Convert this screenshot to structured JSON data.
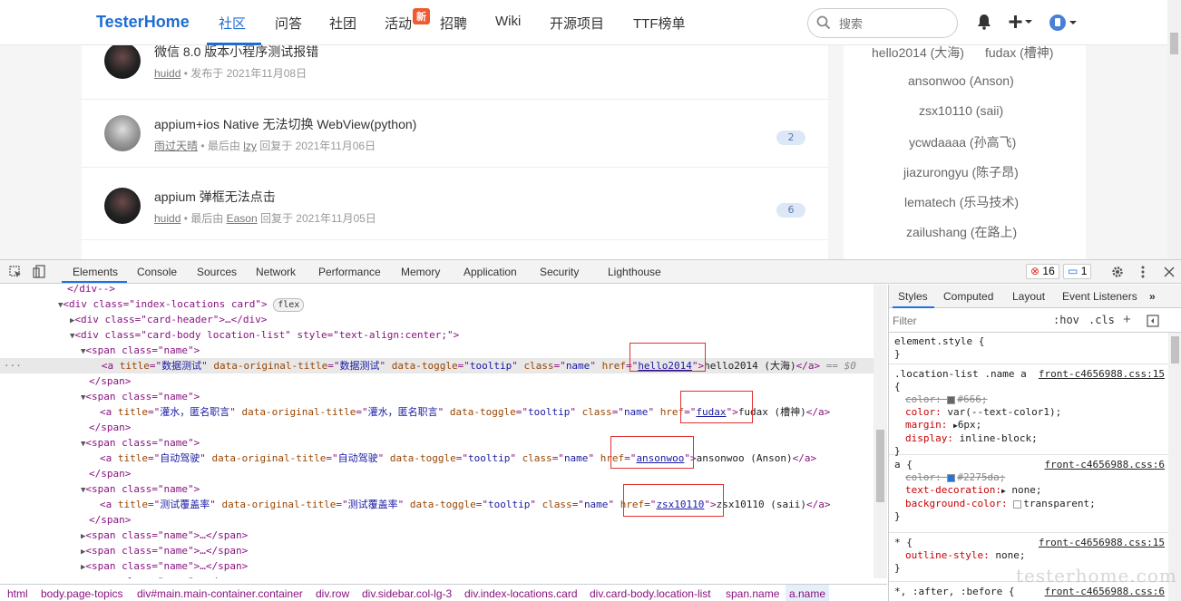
{
  "nav": {
    "brand": "TesterHome",
    "items": [
      "社区",
      "问答",
      "社团",
      "活动",
      "招聘",
      "Wiki",
      "开源项目",
      "TTF榜单"
    ],
    "badge": "新",
    "search_placeholder": "搜索"
  },
  "topics": [
    {
      "title": "微信 8.0 版本小程序测试报错",
      "author": "huidd",
      "meta": " • 发布于 2021年11月08日",
      "replier": "",
      "replies": ""
    },
    {
      "title": "appium+ios Native 无法切换 WebView(python)",
      "author": "雨过天晴",
      "meta_a": " • 最后由 ",
      "replier": "lzy",
      "meta_b": " 回复于 2021年11月06日",
      "replies": "2"
    },
    {
      "title": "appium 弹框无法点击",
      "author": "huidd",
      "meta_a": " • 最后由 ",
      "replier": "Eason",
      "meta_b": " 回复于 2021年11月05日",
      "replies": "6"
    }
  ],
  "locations": {
    "row1a": "hello2014 (大海)",
    "row1b": "fudax (槽神)",
    "others": [
      "ansonwoo (Anson)",
      "zsx10110 (saii)",
      "ycwdaaaa (孙高飞)",
      "jiazurongyu (陈子昂)",
      "lematech (乐马技术)",
      "zailushang (在路上)"
    ]
  },
  "devtools": {
    "tabs": [
      "Elements",
      "Console",
      "Sources",
      "Network",
      "Performance",
      "Memory",
      "Application",
      "Security",
      "Lighthouse"
    ],
    "errors": "16",
    "messages": "1",
    "style_tabs": [
      "Styles",
      "Computed",
      "Layout",
      "Event Listeners"
    ],
    "filter_placeholder": "Filter",
    "hov": ":hov",
    "cls": ".cls"
  },
  "dom": {
    "l0": "</div-->",
    "l1_tag": "<div class=\"index-locations card\">",
    "l1_flex": "flex",
    "l2": "<div class=\"card-header\">…</div>",
    "l3": "<div class=\"card-body location-list\" style=\"text-align:center;\">",
    "span_open": "<span class=\"name\">",
    "span_close": "</span>",
    "span_collapsed": "<span class=\"name\">…</span>",
    "a1_title": "数据测试",
    "a1_href": "hello2014",
    "a1_text": "hello2014 (大海)",
    "a2_title": "灌水，匿名职言",
    "a2_href": "fudax",
    "a2_text": "fudax (槽神)",
    "a3_title": "自动驾驶",
    "a3_href": "ansonwoo",
    "a3_text": "ansonwoo (Anson)",
    "a4_title": "测试覆盖率",
    "a4_href": "zsx10110",
    "a4_text": "zsx10110 (saii)",
    "eq0": "== $0"
  },
  "breadcrumbs": [
    "html",
    "body.page-topics",
    "div#main.main-container.container",
    "div.row",
    "div.sidebar.col-lg-3",
    "div.index-locations.card",
    "div.card-body.location-list",
    "span.name",
    "a.name"
  ],
  "styles": {
    "element_style": "element.style {",
    "r1_sel": ".location-list .name a",
    "r1_src": "front-c4656988.css:15",
    "r1_p1": "color:",
    "r1_v1": "#666;",
    "r1_p2": "color:",
    "r1_v2": "var(--text-color1);",
    "r1_p3": "margin:",
    "r1_v3": "6px;",
    "r1_p4": "display:",
    "r1_v4": "inline-block;",
    "r2_sel": "a {",
    "r2_src": "front-c4656988.css:6",
    "r2_p1": "color:",
    "r2_v1": "#2275da;",
    "r2_p2": "text-decoration:",
    "r2_v2": "none;",
    "r2_p3": "background-color:",
    "r2_v3": "transparent;",
    "r3_sel": "* {",
    "r3_src": "front-c4656988.css:15",
    "r3_p1": "outline-style:",
    "r3_v1": "none;",
    "r4_sel": "*, :after, :before {",
    "r4_src": "front-c4656988.css:6"
  },
  "watermark": "testerhome.com",
  "colors": {
    "brand": "#1f6dd1",
    "badge": "#ef5a30",
    "highlight_box": "#e03030",
    "swatch_666": "#666666",
    "swatch_blue": "#2275da"
  }
}
